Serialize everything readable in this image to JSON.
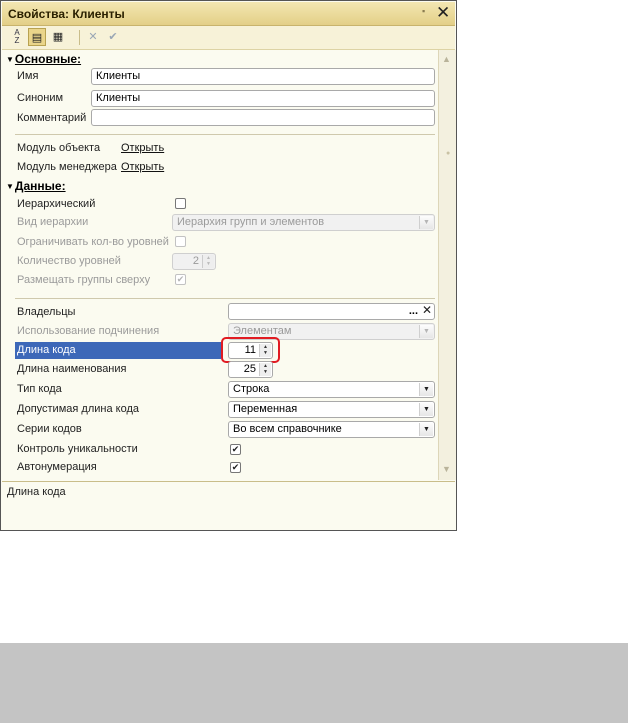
{
  "window": {
    "title": "Свойства: Клиенты",
    "pin_icon": "pin-icon",
    "close_icon": "close-icon"
  },
  "toolbar": {
    "sort_label": "↓A↓Z",
    "categories_label": "▤",
    "filter_label": "▦",
    "cancel_label": "✕",
    "apply_label": "✔"
  },
  "groups": {
    "basic": "Основные:",
    "data": "Данные:"
  },
  "basic": {
    "name_label": "Имя",
    "name_value": "Клиенты",
    "synonym_label": "Синоним",
    "synonym_value": "Клиенты",
    "comment_label": "Комментарий",
    "comment_value": "",
    "object_module_label": "Модуль объекта",
    "object_module_link": "Открыть",
    "manager_module_label": "Модуль менеджера",
    "manager_module_link": "Открыть"
  },
  "data": {
    "hierarchical_label": "Иерархический",
    "hierarchical_checked": false,
    "hierarchy_type_label": "Вид иерархии",
    "hierarchy_type_value": "Иерархия групп и элементов",
    "limit_levels_label": "Ограничивать кол-во уровней",
    "levels_count_label": "Количество уровней",
    "levels_count_value": "2",
    "groups_on_top_label": "Размещать группы сверху",
    "owners_label": "Владельцы",
    "owners_value": "",
    "owners_select": "...",
    "subordination_label": "Использование подчинения",
    "subordination_value": "Элементам",
    "code_length_label": "Длина кода",
    "code_length_value": "11",
    "name_length_label": "Длина наименования",
    "name_length_value": "25",
    "code_type_label": "Тип кода",
    "code_type_value": "Строка",
    "code_allowed_label": "Допустимая длина кода",
    "code_allowed_value": "Переменная",
    "code_series_label": "Серии кодов",
    "code_series_value": "Во всем справочнике",
    "uniqueness_label": "Контроль уникальности",
    "autonumber_label": "Автонумерация"
  },
  "description": {
    "text": "Длина кода"
  },
  "colors": {
    "title_bar": "#e8d58f",
    "selection": "#3d68b8",
    "highlight": "#e11b22",
    "panel_bg": "#fbfbf0"
  }
}
